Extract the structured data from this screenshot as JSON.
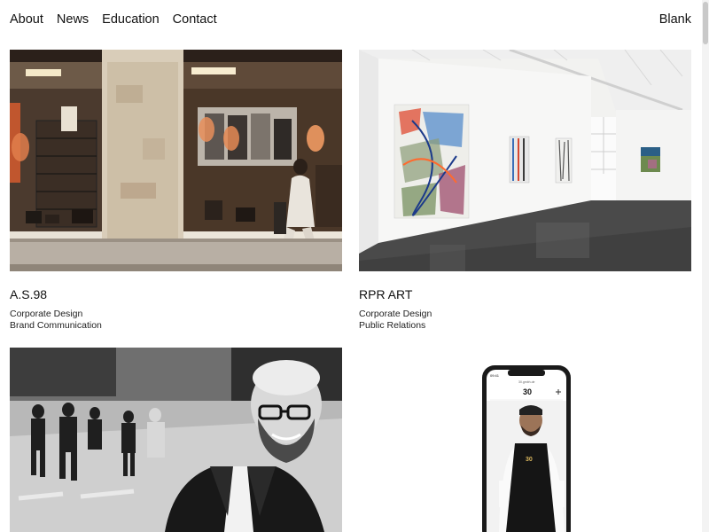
{
  "nav": {
    "items": [
      "About",
      "News",
      "Education",
      "Contact"
    ],
    "brand": "Blank"
  },
  "projects": [
    {
      "title": "A.S.98",
      "tags": [
        "Corporate Design",
        "Brand Communication"
      ]
    },
    {
      "title": "RPR ART",
      "tags": [
        "Corporate Design",
        "Public Relations"
      ]
    }
  ],
  "phone": {
    "time": "09:41",
    "url": "30.gmbh.de",
    "logo_number": "30"
  }
}
